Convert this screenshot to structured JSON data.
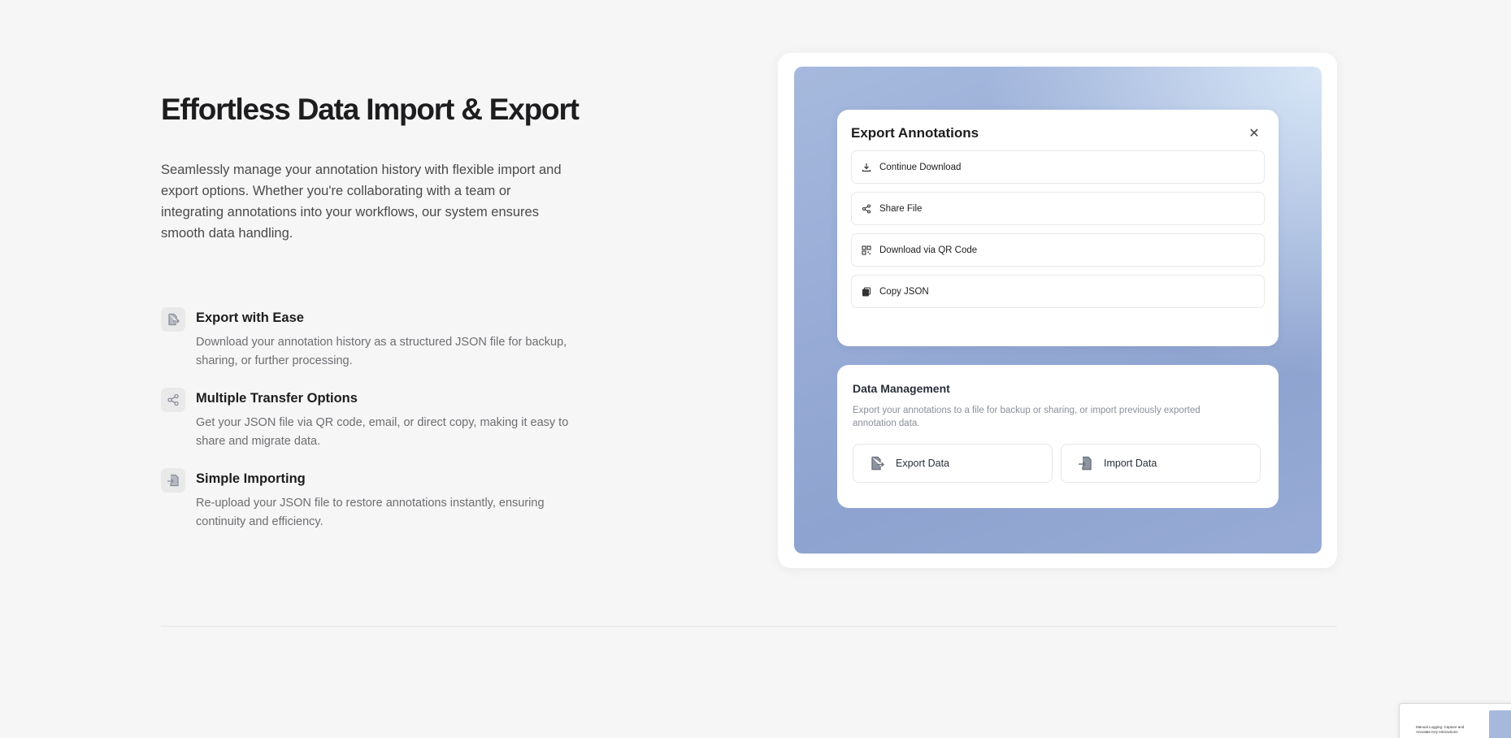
{
  "hero": {
    "title": "Effortless Data Import & Export",
    "intro": "Seamlessly manage your annotation history with flexible import and export options. Whether you're collaborating with a team or integrating annotations into your workflows, our system ensures smooth data handling."
  },
  "features": [
    {
      "icon": "file-export-icon",
      "title": "Export with Ease",
      "description": "Download your annotation history as a structured JSON file for backup, sharing, or further processing."
    },
    {
      "icon": "share-icon",
      "title": "Multiple Transfer Options",
      "description": "Get your JSON file via QR code, email, or direct copy, making it easy to share and migrate data."
    },
    {
      "icon": "file-import-icon",
      "title": "Simple Importing",
      "description": "Re-upload your JSON file to restore annotations instantly, ensuring continuity and efficiency."
    }
  ],
  "export_modal": {
    "title": "Export Annotations",
    "close_icon": "close-icon",
    "options": [
      {
        "icon": "download-icon",
        "label": "Continue Download"
      },
      {
        "icon": "share-icon",
        "label": "Share File"
      },
      {
        "icon": "qr-code-icon",
        "label": "Download via QR Code"
      },
      {
        "icon": "copy-icon",
        "label": "Copy JSON"
      }
    ]
  },
  "data_management": {
    "title": "Data Management",
    "description": "Export your annotations to a file for backup or sharing, or import previously exported annotation data.",
    "export_label": "Export Data",
    "import_label": "Import Data"
  },
  "thumbnail": {
    "text": "Manual Logging: Capture and Annotate Key Interactions"
  },
  "colors": {
    "background": "#f6f6f6",
    "gradient_start": "#a6b9dd",
    "gradient_end": "#8ea3cf",
    "text_primary": "#1d1d1f",
    "text_secondary": "#6e6e73"
  }
}
